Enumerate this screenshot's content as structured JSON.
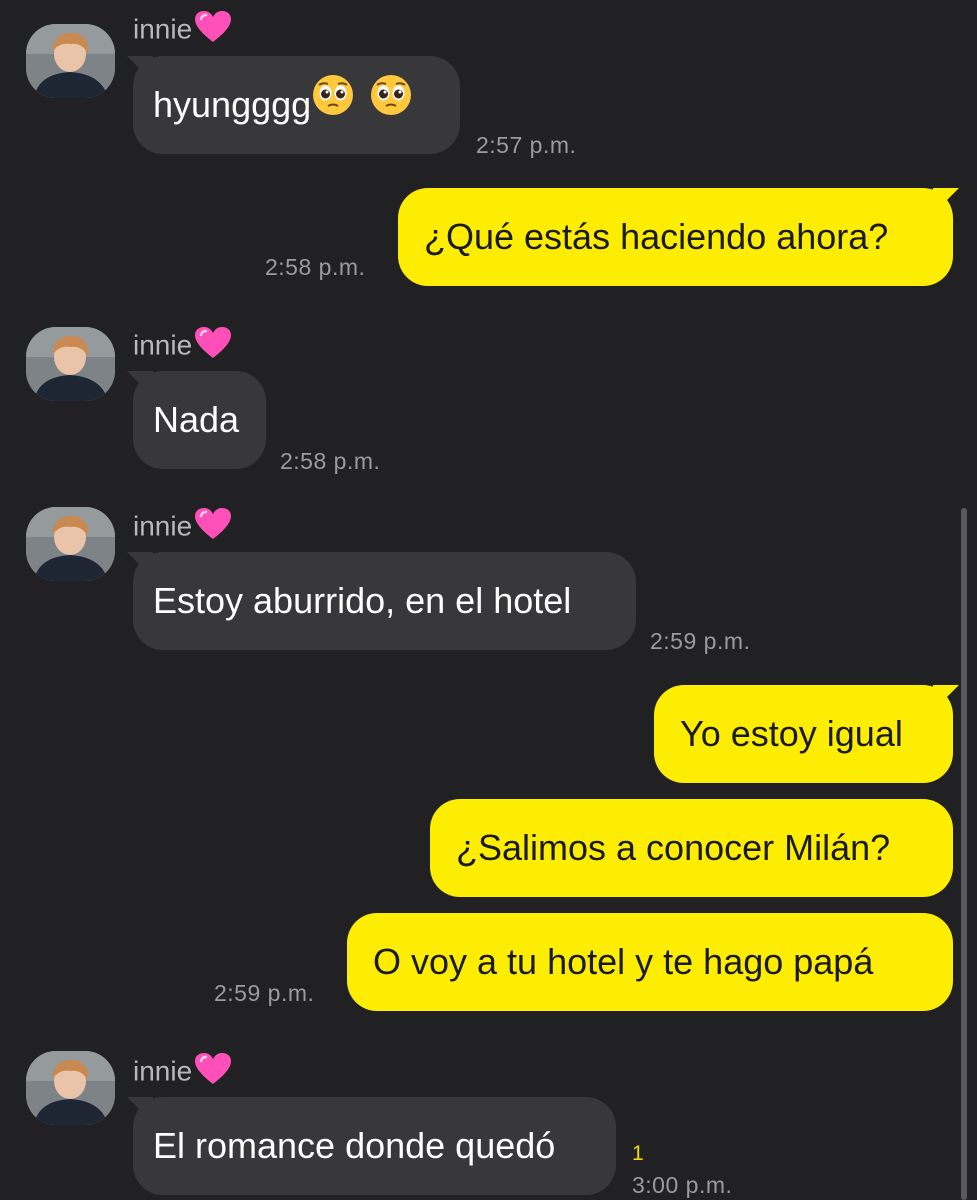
{
  "contact": {
    "name": "innie",
    "name_emoji": "pink-heart"
  },
  "colors": {
    "background": "#212124",
    "incoming_bubble": "#38383b",
    "outgoing_bubble": "#fded02",
    "timestamp": "#9a9aa0",
    "unread_count": "#f5d800"
  },
  "messages": [
    {
      "direction": "incoming",
      "text": "hyungggg",
      "emojis": [
        "pleading-face",
        "pleading-face"
      ],
      "time": "2:57 p.m."
    },
    {
      "direction": "outgoing",
      "text": "¿Qué estás haciendo ahora?",
      "time": "2:58 p.m."
    },
    {
      "direction": "incoming",
      "text": "Nada",
      "time": "2:58 p.m."
    },
    {
      "direction": "incoming",
      "text": "Estoy aburrido, en el hotel",
      "time": "2:59 p.m."
    },
    {
      "direction": "outgoing",
      "text": "Yo estoy igual"
    },
    {
      "direction": "outgoing",
      "text": "¿Salimos a conocer Milán?"
    },
    {
      "direction": "outgoing",
      "text": "O voy a tu hotel y te hago papá",
      "time": "2:59 p.m."
    },
    {
      "direction": "incoming",
      "text": "El romance donde quedó",
      "time": "3:00 p.m.",
      "unread": "1"
    }
  ]
}
